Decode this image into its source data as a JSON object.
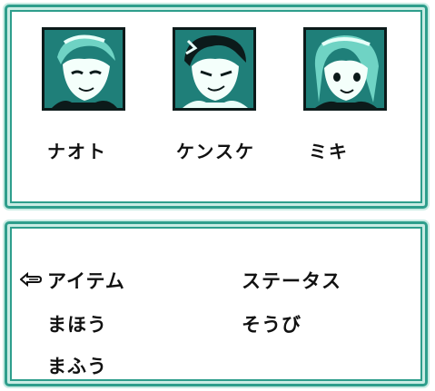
{
  "party": [
    {
      "name": "ナオト"
    },
    {
      "name": "ケンスケ"
    },
    {
      "name": "ミキ"
    }
  ],
  "menu": {
    "item": "アイテム",
    "magic": "まほう",
    "seal": "まふう",
    "status": "ステータス",
    "equip": "そうび",
    "selected": "アイテム"
  },
  "colors": {
    "frame": "#2e9e8c",
    "frame_light": "#c9ece4",
    "portrait_bg": "#1f7f79",
    "text": "#111111"
  },
  "icons": [
    "hand-pointer-icon"
  ]
}
